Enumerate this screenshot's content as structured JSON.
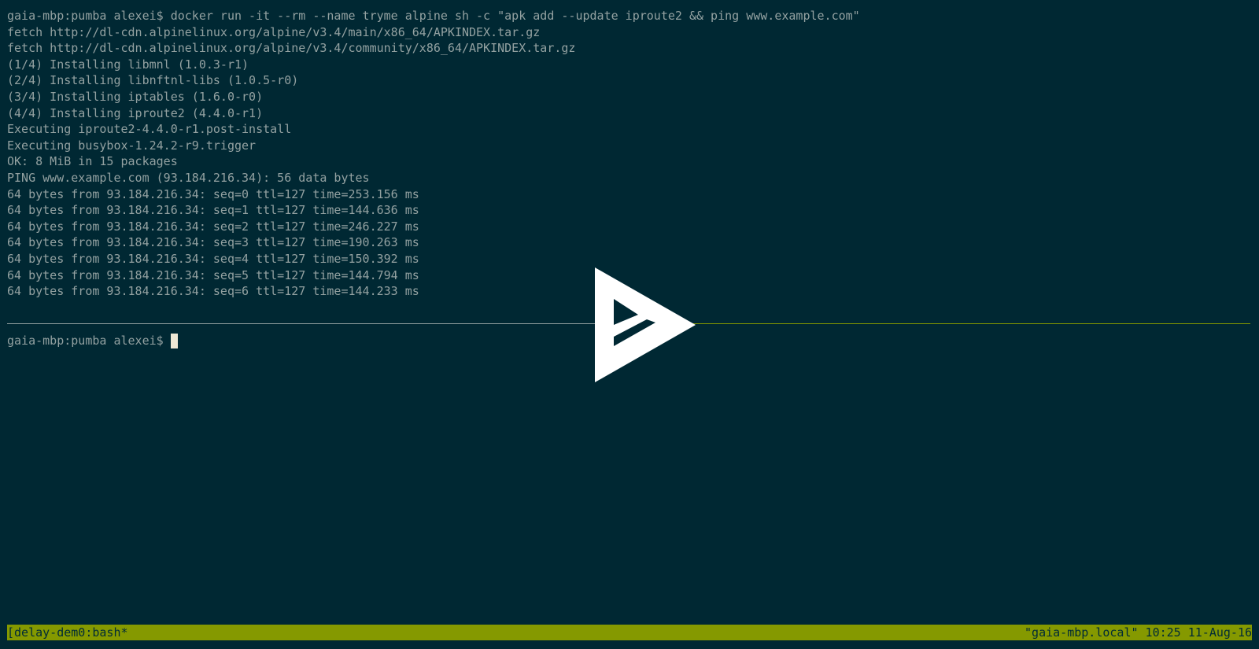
{
  "terminal": {
    "lines": [
      "gaia-mbp:pumba alexei$ docker run -it --rm --name tryme alpine sh -c \"apk add --update iproute2 && ping www.example.com\"",
      "fetch http://dl-cdn.alpinelinux.org/alpine/v3.4/main/x86_64/APKINDEX.tar.gz",
      "fetch http://dl-cdn.alpinelinux.org/alpine/v3.4/community/x86_64/APKINDEX.tar.gz",
      "(1/4) Installing libmnl (1.0.3-r1)",
      "(2/4) Installing libnftnl-libs (1.0.5-r0)",
      "(3/4) Installing iptables (1.6.0-r0)",
      "(4/4) Installing iproute2 (4.4.0-r1)",
      "Executing iproute2-4.4.0-r1.post-install",
      "Executing busybox-1.24.2-r9.trigger",
      "OK: 8 MiB in 15 packages",
      "PING www.example.com (93.184.216.34): 56 data bytes",
      "64 bytes from 93.184.216.34: seq=0 ttl=127 time=253.156 ms",
      "64 bytes from 93.184.216.34: seq=1 ttl=127 time=144.636 ms",
      "64 bytes from 93.184.216.34: seq=2 ttl=127 time=246.227 ms",
      "64 bytes from 93.184.216.34: seq=3 ttl=127 time=190.263 ms",
      "64 bytes from 93.184.216.34: seq=4 ttl=127 time=150.392 ms",
      "64 bytes from 93.184.216.34: seq=5 ttl=127 time=144.794 ms",
      "64 bytes from 93.184.216.34: seq=6 ttl=127 time=144.233 ms"
    ],
    "prompt": "gaia-mbp:pumba alexei$"
  },
  "status_bar": {
    "left": "[delay-dem0:bash*",
    "right": "\"gaia-mbp.local\" 10:25 11-Aug-16"
  },
  "overlay": {
    "icon": "play-icon"
  },
  "colors": {
    "background": "#002833",
    "foreground": "#93a1a1",
    "accent": "#859900",
    "cursor": "#eee8d5",
    "overlay": "#ffffff"
  }
}
